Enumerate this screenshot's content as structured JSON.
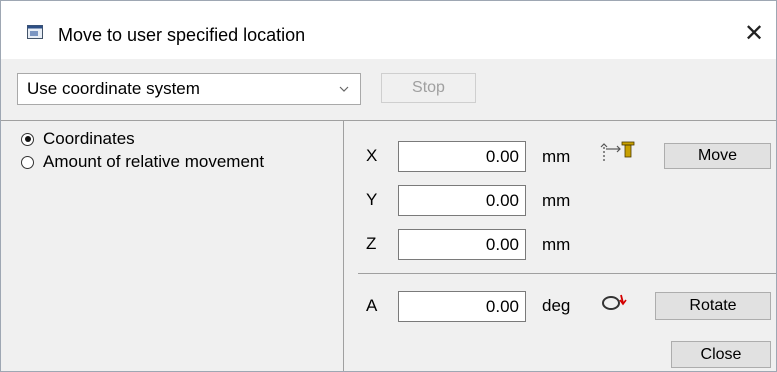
{
  "window": {
    "title": "Move to user specified location",
    "close_glyph": "✕",
    "title_icon": "app-window-icon"
  },
  "toolbar": {
    "mode_select": {
      "selected": "Use coordinate system",
      "icon": "chevron-down-icon"
    },
    "stop_label": "Stop"
  },
  "modes": [
    {
      "label": "Coordinates",
      "checked": true
    },
    {
      "label": "Amount of relative movement",
      "checked": false
    }
  ],
  "axes": [
    {
      "label": "X",
      "value": "0.00",
      "unit": "mm"
    },
    {
      "label": "Y",
      "value": "0.00",
      "unit": "mm"
    },
    {
      "label": "Z",
      "value": "0.00",
      "unit": "mm"
    }
  ],
  "rotation": {
    "label": "A",
    "value": "0.00",
    "unit": "deg"
  },
  "actions": {
    "move_label": "Move",
    "move_icon": "move-tool-icon",
    "rotate_label": "Rotate",
    "rotate_icon": "rotate-icon",
    "close_label": "Close"
  },
  "colors": {
    "move_icon_accent": "#c8a000",
    "rotate_icon_accent": "#d40000"
  }
}
